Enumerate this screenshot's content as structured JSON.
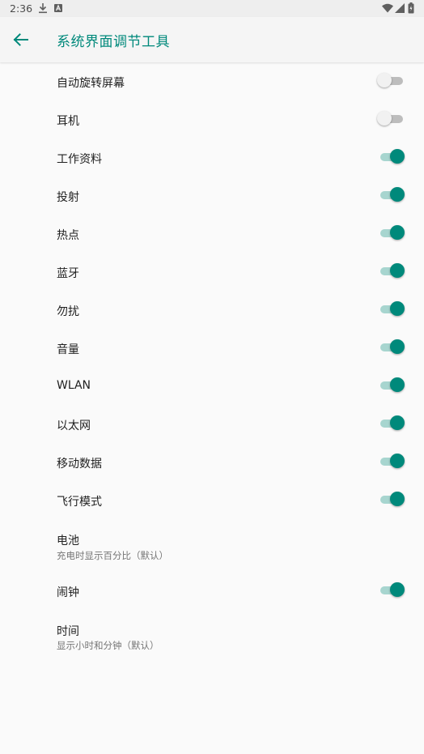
{
  "status_bar": {
    "time": "2:36",
    "icons": [
      "download-icon",
      "a-badge-icon",
      "wifi-icon",
      "signal-icon",
      "battery-icon"
    ]
  },
  "app_bar": {
    "title": "系统界面调节工具",
    "back_icon": "arrow-back-icon"
  },
  "colors": {
    "accent": "#00897b",
    "accent_track": "#a7d5cf",
    "off_thumb": "#f1f1f1",
    "off_track": "#bdbdbd"
  },
  "items": [
    {
      "label": "自动旋转屏幕",
      "toggle": true,
      "checked": false
    },
    {
      "label": "耳机",
      "toggle": true,
      "checked": false
    },
    {
      "label": "工作资料",
      "toggle": true,
      "checked": true
    },
    {
      "label": "投射",
      "toggle": true,
      "checked": true
    },
    {
      "label": "热点",
      "toggle": true,
      "checked": true
    },
    {
      "label": "蓝牙",
      "toggle": true,
      "checked": true
    },
    {
      "label": "勿扰",
      "toggle": true,
      "checked": true
    },
    {
      "label": "音量",
      "toggle": true,
      "checked": true
    },
    {
      "label": "WLAN",
      "toggle": true,
      "checked": true
    },
    {
      "label": "以太网",
      "toggle": true,
      "checked": true
    },
    {
      "label": "移动数据",
      "toggle": true,
      "checked": true
    },
    {
      "label": "飞行模式",
      "toggle": true,
      "checked": true
    },
    {
      "label": "电池",
      "subtitle": "充电时显示百分比（默认）",
      "toggle": false
    },
    {
      "label": "闹钟",
      "toggle": true,
      "checked": true
    },
    {
      "label": "时间",
      "subtitle": "显示小时和分钟（默认）",
      "toggle": false
    }
  ]
}
